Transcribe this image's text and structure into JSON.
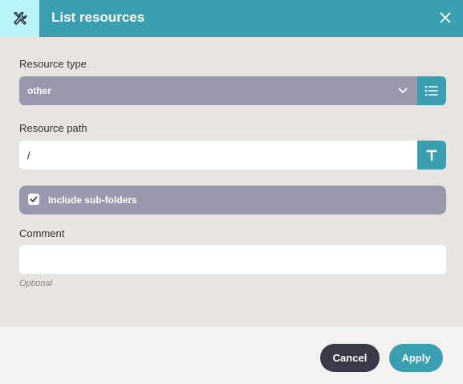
{
  "dialog": {
    "title": "List resources",
    "header_icon": "tools-icon",
    "close_icon": "close-icon"
  },
  "resource_type": {
    "label": "Resource type",
    "value": "other",
    "icon": "chevron-down-icon",
    "side_icon": "list-icon"
  },
  "resource_path": {
    "label": "Resource path",
    "value": "/",
    "side_icon": "text-type-icon"
  },
  "include_subfolders": {
    "label": "Include sub-folders",
    "checked": true
  },
  "comment": {
    "label": "Comment",
    "value": "",
    "hint": "Optional"
  },
  "footer": {
    "cancel_label": "Cancel",
    "apply_label": "Apply"
  },
  "colors": {
    "accent": "#3b9fb2",
    "header_icon_bg": "#b8f4fa",
    "field_bg": "#9998ad",
    "dark_button": "#3b3a4a",
    "panel_bg": "#e8e4e1"
  }
}
